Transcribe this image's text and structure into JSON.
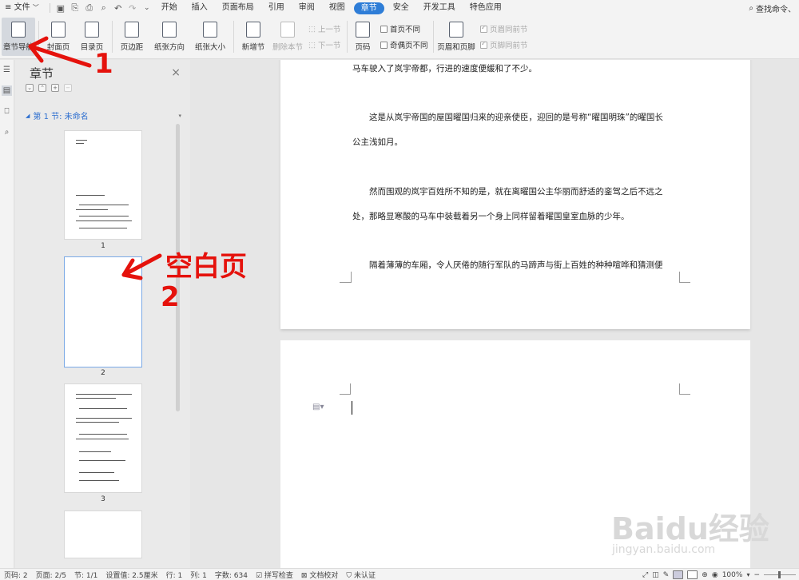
{
  "menubar": {
    "file_label": "文件",
    "tabs": [
      "开始",
      "插入",
      "页面布局",
      "引用",
      "审阅",
      "视图",
      "章节",
      "安全",
      "开发工具",
      "特色应用"
    ],
    "active_tab": "章节",
    "search_placeholder": "查找命令、"
  },
  "ribbon": {
    "chapter_nav": "章节导航",
    "cover": "封面页",
    "toc": "目录页",
    "margins": "页边距",
    "orientation": "纸张方向",
    "size": "纸张大小",
    "new_section": "新增节",
    "delete_section": "删除本节",
    "prev_section": "上一节",
    "next_section": "下一节",
    "page_number": "页码",
    "first_page_diff": "首页不同",
    "odd_even_diff": "奇偶页不同",
    "header_footer": "页眉和页脚",
    "header_same_prev": "页眉同前节",
    "footer_same_prev": "页脚同前节"
  },
  "nav": {
    "title": "章节",
    "section_label": "第 1 节: 未命名",
    "pages": [
      "1",
      "2",
      "3"
    ]
  },
  "document": {
    "page1_lines": [
      "马车驶入了岚宇帝都，行进的速度便缓和了不少。",
      "这是从岚宇帝国的屋国曜国归来的迎亲使臣，迎回的是号称“曜国明珠”的曜国长",
      "公主浅如月。",
      "然而围观的岚宇百姓所不知的是，就在离曜国公主华丽而舒适的銮驾之后不远之",
      "处，那略显寒酸的马车中装载着另一个身上同样留着曜国皇室血脉的少年。",
      "隔着薄薄的车厢，令人厌倦的随行军队的马蹄声与街上百姓的种种喧哗和猜测便"
    ]
  },
  "annotations": {
    "arrow1_label": "1",
    "blank_page_label": "空白页",
    "arrow2_label": "2"
  },
  "watermark": {
    "brand": "Baidu经验",
    "url": "jingyan.baidu.com"
  },
  "statusbar": {
    "page_num": "页码: 2",
    "page_count": "页面: 2/5",
    "section": "节: 1/1",
    "setting": "设置值: 2.5厘米",
    "row": "行: 1",
    "col": "列: 1",
    "word_count": "字数: 634",
    "spell_check": "拼写检查",
    "doc_proof": "文档校对",
    "uncertified": "未认证",
    "zoom": "100%"
  },
  "colors": {
    "accent": "#2e7dd7",
    "annotation_red": "#e5120c",
    "nav_section_blue": "#2e6fcf"
  }
}
